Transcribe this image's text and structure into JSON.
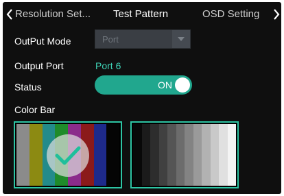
{
  "tabs": [
    {
      "label": "Resolution Set..."
    },
    {
      "label": "Test Pattern",
      "active": true
    },
    {
      "label": "OSD Setting"
    }
  ],
  "fields": {
    "output_mode": {
      "label": "OutPut Mode",
      "value": "Port"
    },
    "output_port": {
      "label": "Output Port",
      "value": "Port 6"
    },
    "status": {
      "label": "Status",
      "value": "ON"
    },
    "color_bar": {
      "label": "Color Bar"
    }
  },
  "patterns": {
    "color_bar": {
      "selected": true,
      "colors": [
        "#8b8b8b",
        "#8c8a12",
        "#238b8b",
        "#1f8b2a",
        "#8b2b8b",
        "#8b1a1a",
        "#1e2a8b",
        "#050505"
      ]
    },
    "grayscale": {
      "selected": false,
      "colors": [
        "#080808",
        "#1b1b1b",
        "#2d2d2d",
        "#404040",
        "#555555",
        "#6c6c6c",
        "#838383",
        "#9a9a9a",
        "#b2b2b2",
        "#c9c9c9",
        "#e0e0e0",
        "#f4f4f4"
      ]
    }
  },
  "colors": {
    "accent": "#2dc5a4",
    "toggle_on": "#21a78e",
    "port_value": "#3fd3b6"
  },
  "icons": {
    "left_arrow": "chevron-left-icon",
    "right_arrow": "chevron-right-icon",
    "dropdown": "chevron-down-icon",
    "selected": "checkmark-icon"
  }
}
